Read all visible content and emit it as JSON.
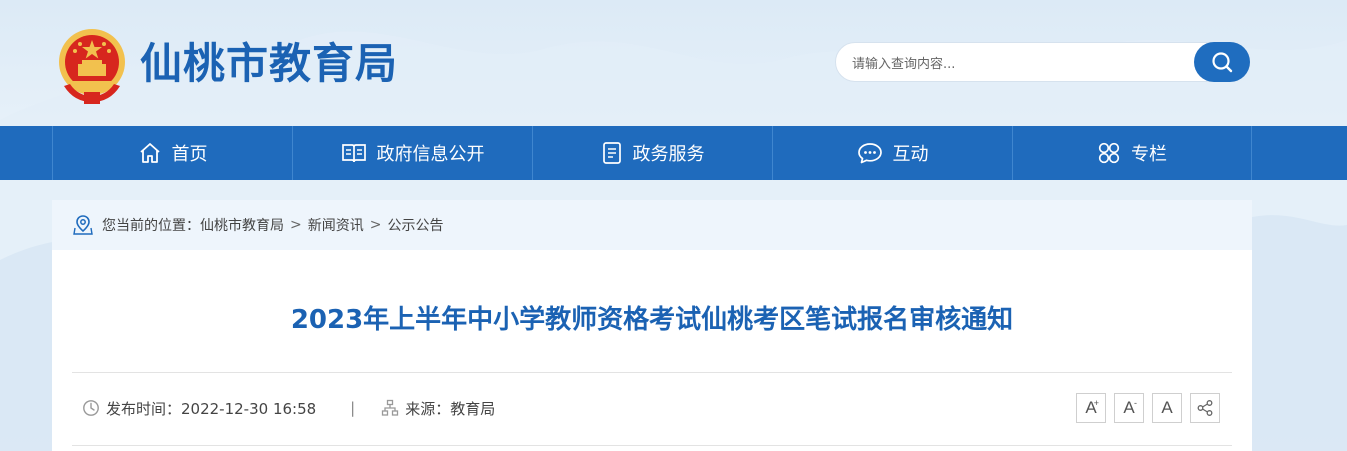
{
  "header": {
    "site_title": "仙桃市教育局",
    "search_placeholder": "请输入查询内容..."
  },
  "nav": {
    "items": [
      {
        "label": "首页",
        "icon": "home-icon"
      },
      {
        "label": "政府信息公开",
        "icon": "book-icon"
      },
      {
        "label": "政务服务",
        "icon": "document-icon"
      },
      {
        "label": "互动",
        "icon": "chat-icon"
      },
      {
        "label": "专栏",
        "icon": "grid-icon"
      }
    ]
  },
  "breadcrumb": {
    "prefix": "您当前的位置：",
    "items": [
      "仙桃市教育局",
      "新闻资讯",
      "公示公告"
    ],
    "separator": ">"
  },
  "article": {
    "title": "2023年上半年中小学教师资格考试仙桃考区笔试报名审核通知",
    "published_label": "发布时间：2022-12-30 16:58",
    "divider": "|",
    "source_label": "来源：教育局"
  },
  "tools": {
    "font_large": "A",
    "font_large_mark": "+",
    "font_small": "A",
    "font_small_mark": "-",
    "font_default": "A"
  },
  "colors": {
    "brand_blue": "#1b62b3",
    "nav_blue": "#1f6bbd",
    "emblem_red": "#d7261e",
    "emblem_gold": "#f2c14e"
  }
}
